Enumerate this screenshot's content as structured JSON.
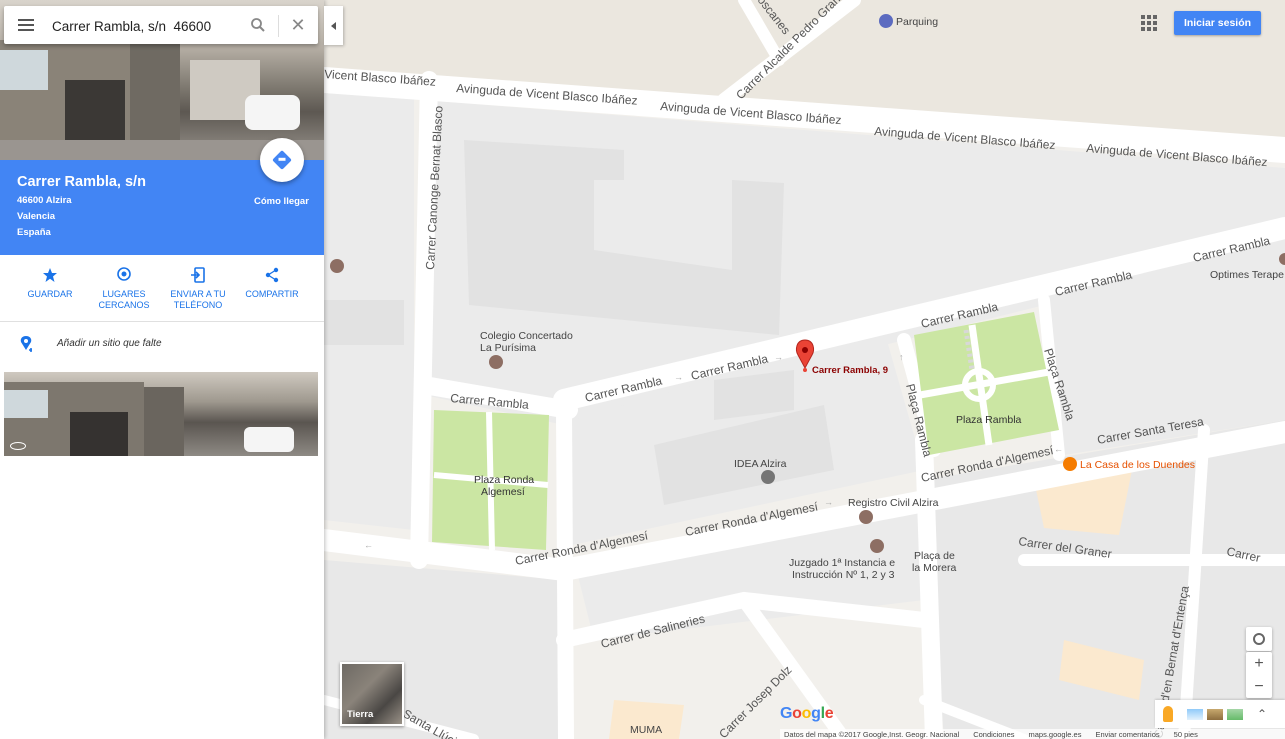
{
  "search": {
    "value": "Carrer Rambla, s/n  46600"
  },
  "place": {
    "title": "Carrer Rambla, s/n",
    "address_lines": [
      "46600 Alzira",
      "Valencia",
      "España"
    ],
    "directions_label": "Cómo llegar"
  },
  "actions": [
    {
      "label": "GUARDAR",
      "icon": "star-icon"
    },
    {
      "label": "LUGARES CERCANOS",
      "icon": "nearby-pin-icon"
    },
    {
      "label": "ENVIAR A TU TELÉFONO",
      "icon": "send-to-phone-icon"
    },
    {
      "label": "COMPARTIR",
      "icon": "share-icon"
    }
  ],
  "add_place": {
    "label": "Añadir un sitio que falte"
  },
  "topbar": {
    "signin_label": "Iniciar sesión",
    "parking_label": "Parquing"
  },
  "map": {
    "streets": {
      "avenida_1": "Avinguda de Vicent Blasco Ibáñez",
      "avenida_partial": "Vicent Blasco Ibáñez",
      "canonge": "Carrer Canonge Bernat Blasco",
      "alcalde": "Carrer Alcalde Pedro Grande",
      "top_partial": "oscanes",
      "rambla": "Carrer Rambla",
      "placa_rambla": "Plaça Rambla",
      "santa_teresa": "Carrer Santa Teresa",
      "ronda": "Carrer Ronda d'Algemesí",
      "graner": "Carrer del Graner",
      "carrer_partial": "Carrer",
      "salineries": "Carrer de Salineries",
      "josep_dolz": "Carrer Josep Dolz",
      "santa_llucia": "Santa Llúci",
      "enteca": "Carrer d'en Bernat d'Entença"
    },
    "pois": {
      "colegio": [
        "Colegio Concertado",
        "La Purísima"
      ],
      "idea": "IDEA Alzira",
      "registro": "Registro Civil Alzira",
      "juzgado": [
        "Juzgado 1ª Instancia e",
        "Instrucción Nº 1, 2 y 3"
      ],
      "placa_morera": [
        "Plaça de",
        "la Morera"
      ],
      "casa_duendes": "La Casa de los Duendes",
      "optimes": "Optimes Terape",
      "muma": "MUMA"
    },
    "plazas": {
      "rambla": "Plaza Rambla",
      "ronda": [
        "Plaza Ronda",
        "Algemesí"
      ]
    },
    "marker_label": "Carrer Rambla, 9",
    "earth_label": "Tierra",
    "google_logo": "Google",
    "footer": [
      "Datos del mapa ©2017 Google,Inst. Geogr. Nacional",
      "Condiciones",
      "maps.google.es",
      "Enviar comentarios",
      "50 pies"
    ]
  },
  "colors": {
    "accent": "#4285f4",
    "map_bg": "#f2f0ec",
    "road": "#ffffff",
    "park": "#cbe6a3",
    "marker": "#ea4335",
    "marker_label": "#8b0000"
  }
}
